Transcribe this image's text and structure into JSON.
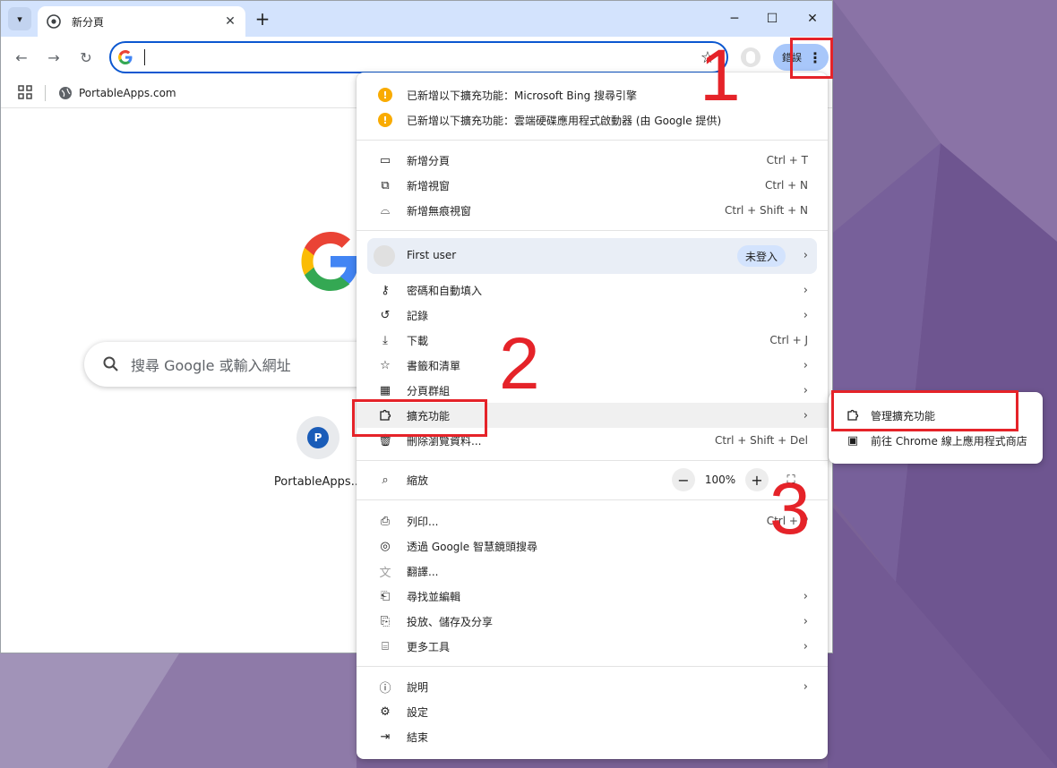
{
  "tab": {
    "title": "新分頁",
    "close_icon": "close-icon"
  },
  "window": {
    "minimize": "─",
    "maximize": "☐",
    "close": "✕"
  },
  "toolbar": {
    "omnibox_value": "",
    "error_chip_label": "錯誤"
  },
  "bookmarks": {
    "items": [
      {
        "label": "PortableApps.com"
      }
    ]
  },
  "ntp": {
    "search_placeholder": "搜尋 Google 或輸入網址",
    "shortcuts": [
      {
        "letter": "P",
        "label": "PortableApps..."
      }
    ]
  },
  "menu": {
    "notices": [
      {
        "label": "已新增以下擴充功能：Microsoft Bing 搜尋引擎"
      },
      {
        "label": "已新增以下擴充功能：雲端硬碟應用程式啟動器 (由 Google 提供)"
      }
    ],
    "new_tab": {
      "label": "新增分頁",
      "shortcut": "Ctrl + T"
    },
    "new_window": {
      "label": "新增視窗",
      "shortcut": "Ctrl + N"
    },
    "incognito": {
      "label": "新增無痕視窗",
      "shortcut": "Ctrl + Shift + N"
    },
    "profile": {
      "name": "First user",
      "status": "未登入"
    },
    "passwords": {
      "label": "密碼和自動填入"
    },
    "history": {
      "label": "記錄"
    },
    "downloads": {
      "label": "下載",
      "shortcut": "Ctrl + J"
    },
    "bookmarks": {
      "label": "書籤和清單"
    },
    "tab_groups": {
      "label": "分頁群組"
    },
    "extensions": {
      "label": "擴充功能"
    },
    "clear_data": {
      "label": "刪除瀏覽資料...",
      "shortcut": "Ctrl + Shift + Del"
    },
    "zoom": {
      "label": "縮放",
      "value": "100%",
      "minus": "−",
      "plus": "+"
    },
    "print": {
      "label": "列印...",
      "shortcut": "Ctrl + P"
    },
    "lens": {
      "label": "透過 Google 智慧鏡頭搜尋"
    },
    "translate": {
      "label": "翻譯..."
    },
    "find_edit": {
      "label": "尋找並編輯"
    },
    "cast_save_share": {
      "label": "投放、儲存及分享"
    },
    "more_tools": {
      "label": "更多工具"
    },
    "help": {
      "label": "說明"
    },
    "settings": {
      "label": "設定"
    },
    "exit": {
      "label": "結束"
    }
  },
  "submenu": {
    "manage": {
      "label": "管理擴充功能"
    },
    "webstore": {
      "label": "前往 Chrome 線上應用程式商店"
    }
  },
  "annotations": {
    "step1": "1",
    "step2": "2",
    "step3": "3",
    "color": "#e52329"
  }
}
